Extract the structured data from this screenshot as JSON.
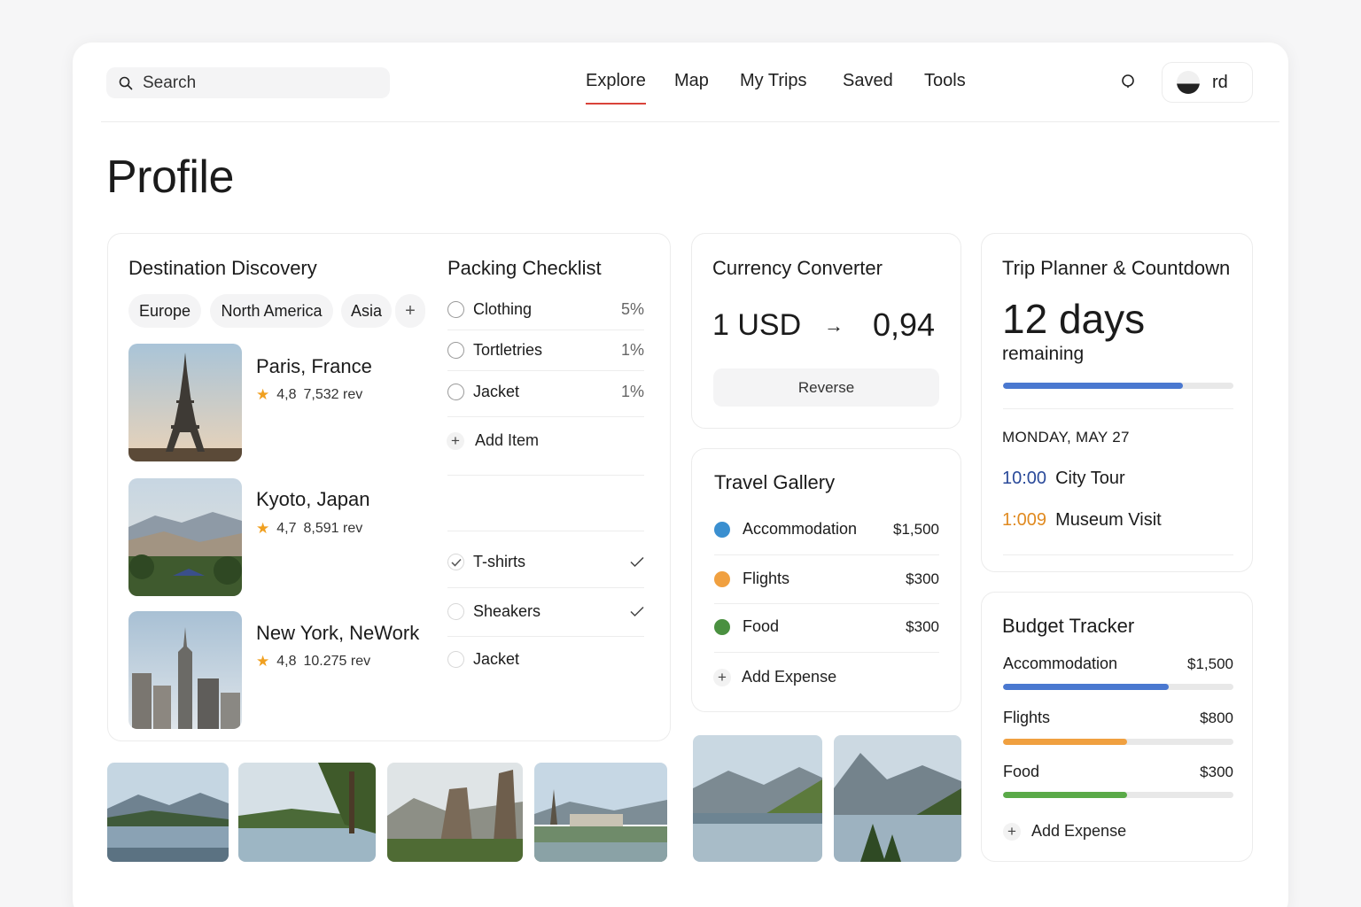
{
  "nav": {
    "search_placeholder": "Search",
    "links": [
      "Explore",
      "Map",
      "My Trips",
      "Saved",
      "Tools"
    ],
    "active": "Explore",
    "user_initials": "rd"
  },
  "page": {
    "title": "Profile"
  },
  "destination": {
    "title": "Destination Discovery",
    "filters": [
      "Europe",
      "North America",
      "Asia"
    ],
    "add_filter": "+",
    "items": [
      {
        "name": "Paris, France",
        "rating": "4,8",
        "reviews": "7,532 rev"
      },
      {
        "name": "Kyoto, Japan",
        "rating": "4,7",
        "reviews": "8,591 rev"
      },
      {
        "name": "New York, NeWork",
        "rating": "4,8",
        "reviews": "10.275 rev"
      }
    ]
  },
  "packing": {
    "title": "Packing Checklist",
    "items": [
      {
        "label": "Clothing",
        "pct": "5%"
      },
      {
        "label": "Tortletries",
        "pct": "1%"
      },
      {
        "label": "Jacket",
        "pct": "1%"
      }
    ],
    "add_label": "Add Item",
    "packed": [
      {
        "label": "T-shirts",
        "checked": true
      },
      {
        "label": "Sheakers",
        "checked": true
      },
      {
        "label": "Jacket",
        "checked": false
      }
    ]
  },
  "currency": {
    "title": "Currency Converter",
    "from_amount": "1 USD",
    "arrow": "→",
    "to_amount": "0,94",
    "reverse_label": "Reverse"
  },
  "gallery": {
    "title": "Travel Gallery",
    "rows": [
      {
        "label": "Accommodation",
        "amount": "$1,500",
        "color": "#3a8fd0"
      },
      {
        "label": "Flights",
        "amount": "$300",
        "color": "#f0a040"
      },
      {
        "label": "Food",
        "amount": "$300",
        "color": "#4a9040"
      }
    ],
    "add_label": "Add Expense"
  },
  "planner": {
    "title": "Trip Planner & Countdown",
    "days": "12 days",
    "remaining": "remaining",
    "progress": 0.78,
    "date": "MONDAY, MAY 27",
    "events": [
      {
        "time": "10:00",
        "name": "City Tour",
        "color": "#2a4a9a"
      },
      {
        "time": "1:009",
        "name": "Museum Visit",
        "color": "#e08a20"
      }
    ]
  },
  "budget": {
    "title": "Budget Tracker",
    "rows": [
      {
        "label": "Accommodation",
        "amount": "$1,500",
        "fill": 0.72,
        "color": "#4a78d0"
      },
      {
        "label": "Flights",
        "amount": "$800",
        "fill": 0.54,
        "color": "#f0a040"
      },
      {
        "label": "Food",
        "amount": "$300",
        "fill": 0.54,
        "color": "#5aaa48"
      }
    ],
    "add_label": "Add Expense"
  },
  "colors": {
    "accent": "#d9433a",
    "progress_blue": "#4a78d0"
  }
}
